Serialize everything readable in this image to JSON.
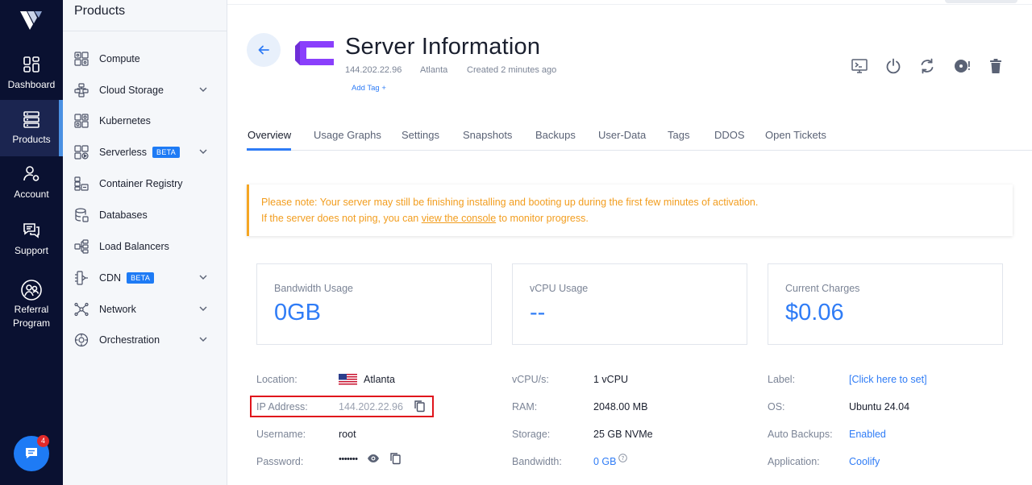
{
  "rail": {
    "items": [
      {
        "label": "Dashboard"
      },
      {
        "label": "Products"
      },
      {
        "label": "Account"
      },
      {
        "label": "Support"
      },
      {
        "label": "Referral Program"
      }
    ],
    "chat_badge": "4"
  },
  "menu": {
    "title": "Products",
    "items": [
      {
        "label": "Compute"
      },
      {
        "label": "Cloud Storage"
      },
      {
        "label": "Kubernetes"
      },
      {
        "label": "Serverless",
        "badge": "BETA"
      },
      {
        "label": "Container Registry"
      },
      {
        "label": "Databases"
      },
      {
        "label": "Load Balancers"
      },
      {
        "label": "CDN",
        "badge": "BETA"
      },
      {
        "label": "Network"
      },
      {
        "label": "Orchestration"
      }
    ]
  },
  "server": {
    "title": "Server Information",
    "ip": "144.202.22.96",
    "location": "Atlanta",
    "created": "Created 2 minutes ago",
    "add_tag": "Add Tag +"
  },
  "tabs": [
    "Overview",
    "Usage Graphs",
    "Settings",
    "Snapshots",
    "Backups",
    "User-Data",
    "Tags",
    "DDOS",
    "Open Tickets"
  ],
  "notice": {
    "line1": "Please note: Your server may still be finishing installing and booting up during the first few minutes of activation.",
    "line2_pre": "If the server does not ping, you can ",
    "line2_link": "view the console",
    "line2_post": " to monitor progress."
  },
  "cards": [
    {
      "label": "Bandwidth Usage",
      "value": "0GB"
    },
    {
      "label": "vCPU Usage",
      "value": "--"
    },
    {
      "label": "Current Charges",
      "value": "$0.06"
    }
  ],
  "details": {
    "col1": [
      {
        "label": "Location:",
        "value": "Atlanta"
      },
      {
        "label": "IP Address:",
        "value": "144.202.22.96"
      },
      {
        "label": "Username:",
        "value": "root"
      },
      {
        "label": "Password:",
        "value": "•••••••"
      }
    ],
    "col2": [
      {
        "label": "vCPU/s:",
        "value": "1 vCPU"
      },
      {
        "label": "RAM:",
        "value": "2048.00 MB"
      },
      {
        "label": "Storage:",
        "value": "25 GB NVMe"
      },
      {
        "label": "Bandwidth:",
        "value": "0 GB"
      }
    ],
    "col3": [
      {
        "label": "Label:",
        "value": "[Click here to set]"
      },
      {
        "label": "OS:",
        "value": "Ubuntu 24.04"
      },
      {
        "label": "Auto Backups:",
        "value": "Enabled"
      },
      {
        "label": "Application:",
        "value": "Coolify"
      }
    ]
  },
  "colors": {
    "rail_bg": "#0a1131",
    "accent": "#2f7cf6",
    "warning": "#f29d1e",
    "highlight_box": "#e0141c",
    "os_logo": "#8a3ffc"
  }
}
